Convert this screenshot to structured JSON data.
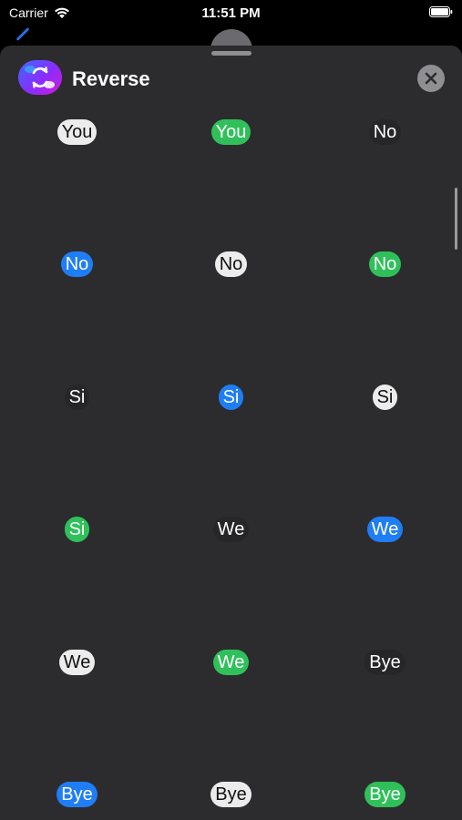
{
  "status_bar": {
    "carrier": "Carrier",
    "time": "11:51 PM"
  },
  "header": {
    "title": "Reverse"
  },
  "colors": {
    "white_bubble": "#ececec",
    "green_bubble": "#30c05a",
    "blue_bubble": "#1f7ef5",
    "dark_bubble": "#262628",
    "sheet": "#2c2c2e"
  },
  "stickers": [
    {
      "text": "You",
      "style": "white"
    },
    {
      "text": "You",
      "style": "green"
    },
    {
      "text": "No",
      "style": "dark"
    },
    {
      "text": "No",
      "style": "blue"
    },
    {
      "text": "No",
      "style": "white"
    },
    {
      "text": "No",
      "style": "green"
    },
    {
      "text": "Si",
      "style": "dark"
    },
    {
      "text": "Si",
      "style": "blue"
    },
    {
      "text": "Si",
      "style": "white"
    },
    {
      "text": "Si",
      "style": "green"
    },
    {
      "text": "We",
      "style": "dark"
    },
    {
      "text": "We",
      "style": "blue"
    },
    {
      "text": "We",
      "style": "white"
    },
    {
      "text": "We",
      "style": "green"
    },
    {
      "text": "Bye",
      "style": "dark"
    },
    {
      "text": "Bye",
      "style": "blue"
    },
    {
      "text": "Bye",
      "style": "white"
    },
    {
      "text": "Bye",
      "style": "green"
    }
  ]
}
